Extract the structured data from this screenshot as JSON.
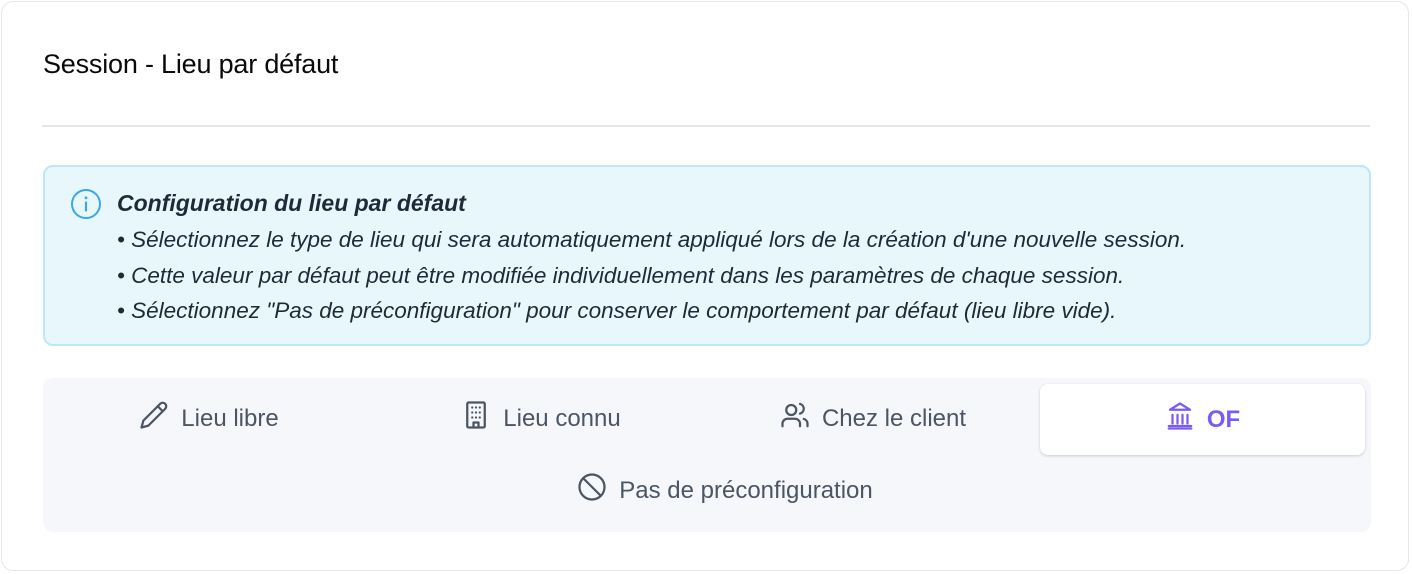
{
  "card": {
    "title": "Session - Lieu par défaut"
  },
  "info": {
    "icon": "info-circle-icon",
    "heading": "Configuration du lieu par défaut",
    "lines": [
      "• Sélectionnez le type de lieu qui sera automatiquement appliqué lors de la création d'une nouvelle session.",
      "• Cette valeur par défaut peut être modifiée individuellement dans les paramètres de chaque session.",
      "• Sélectionnez \"Pas de préconfiguration\" pour conserver le comportement par défaut (lieu libre vide)."
    ],
    "colors": {
      "background": "#e8f7fc",
      "border": "#bde7f7",
      "icon": "#38a9e6"
    }
  },
  "options": {
    "selected": "OF",
    "items": [
      {
        "label": "Lieu libre",
        "icon": "pencil-icon"
      },
      {
        "label": "Lieu connu",
        "icon": "building-icon"
      },
      {
        "label": "Chez le client",
        "icon": "users-icon"
      },
      {
        "label": "OF",
        "icon": "landmark-icon"
      },
      {
        "label": "Pas de préconfiguration",
        "icon": "ban-icon"
      }
    ],
    "colors": {
      "selected_accent": "#7c5cf0",
      "text": "#4b5563",
      "panel_bg": "#f5f7fa"
    }
  }
}
